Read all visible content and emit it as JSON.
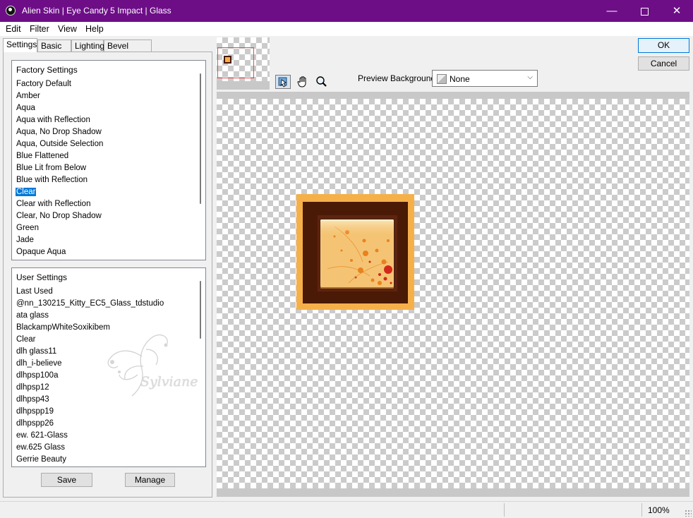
{
  "window": {
    "title": "Alien Skin | Eye Candy 5 Impact | Glass",
    "controls": {
      "minimize": "—",
      "close": "✕"
    }
  },
  "menu": [
    "Edit",
    "Filter",
    "View",
    "Help"
  ],
  "tabs": [
    "Settings",
    "Basic",
    "Lighting",
    "Bevel Profile"
  ],
  "factory_settings": {
    "header": "Factory Settings",
    "items": [
      "Factory Default",
      "Amber",
      "Aqua",
      "Aqua with Reflection",
      "Aqua, No Drop Shadow",
      "Aqua, Outside Selection",
      "Blue Flattened",
      "Blue Lit from Below",
      "Blue with Reflection",
      "Clear",
      "Clear with Reflection",
      "Clear, No Drop Shadow",
      "Green",
      "Jade",
      "Opaque Aqua"
    ],
    "selected": "Clear"
  },
  "user_settings": {
    "header": "User Settings",
    "items": [
      "Last Used",
      "@nn_130215_Kitty_EC5_Glass_tdstudio",
      "ata glass",
      "BlackampWhiteSoxikibem",
      "Clear",
      "dlh glass11",
      "dlh_i-believe",
      "dlhpsp100a",
      "dlhpsp12",
      "dlhpsp43",
      "dlhpspp19",
      "dlhpspp26",
      "ew. 621-Glass",
      "ew.625 Glass",
      "Gerrie Beauty"
    ]
  },
  "buttons": {
    "save": "Save",
    "manage": "Manage",
    "ok": "OK",
    "cancel": "Cancel"
  },
  "preview_background": {
    "label": "Preview Background:",
    "value": "None"
  },
  "status": {
    "zoom": "100%"
  },
  "colors": {
    "title_bar": "#6d0e87",
    "selection": "#0078d7",
    "frame_gold": "#f6b04a",
    "frame_dark": "#4a1a06"
  },
  "watermark": "Sylviane"
}
